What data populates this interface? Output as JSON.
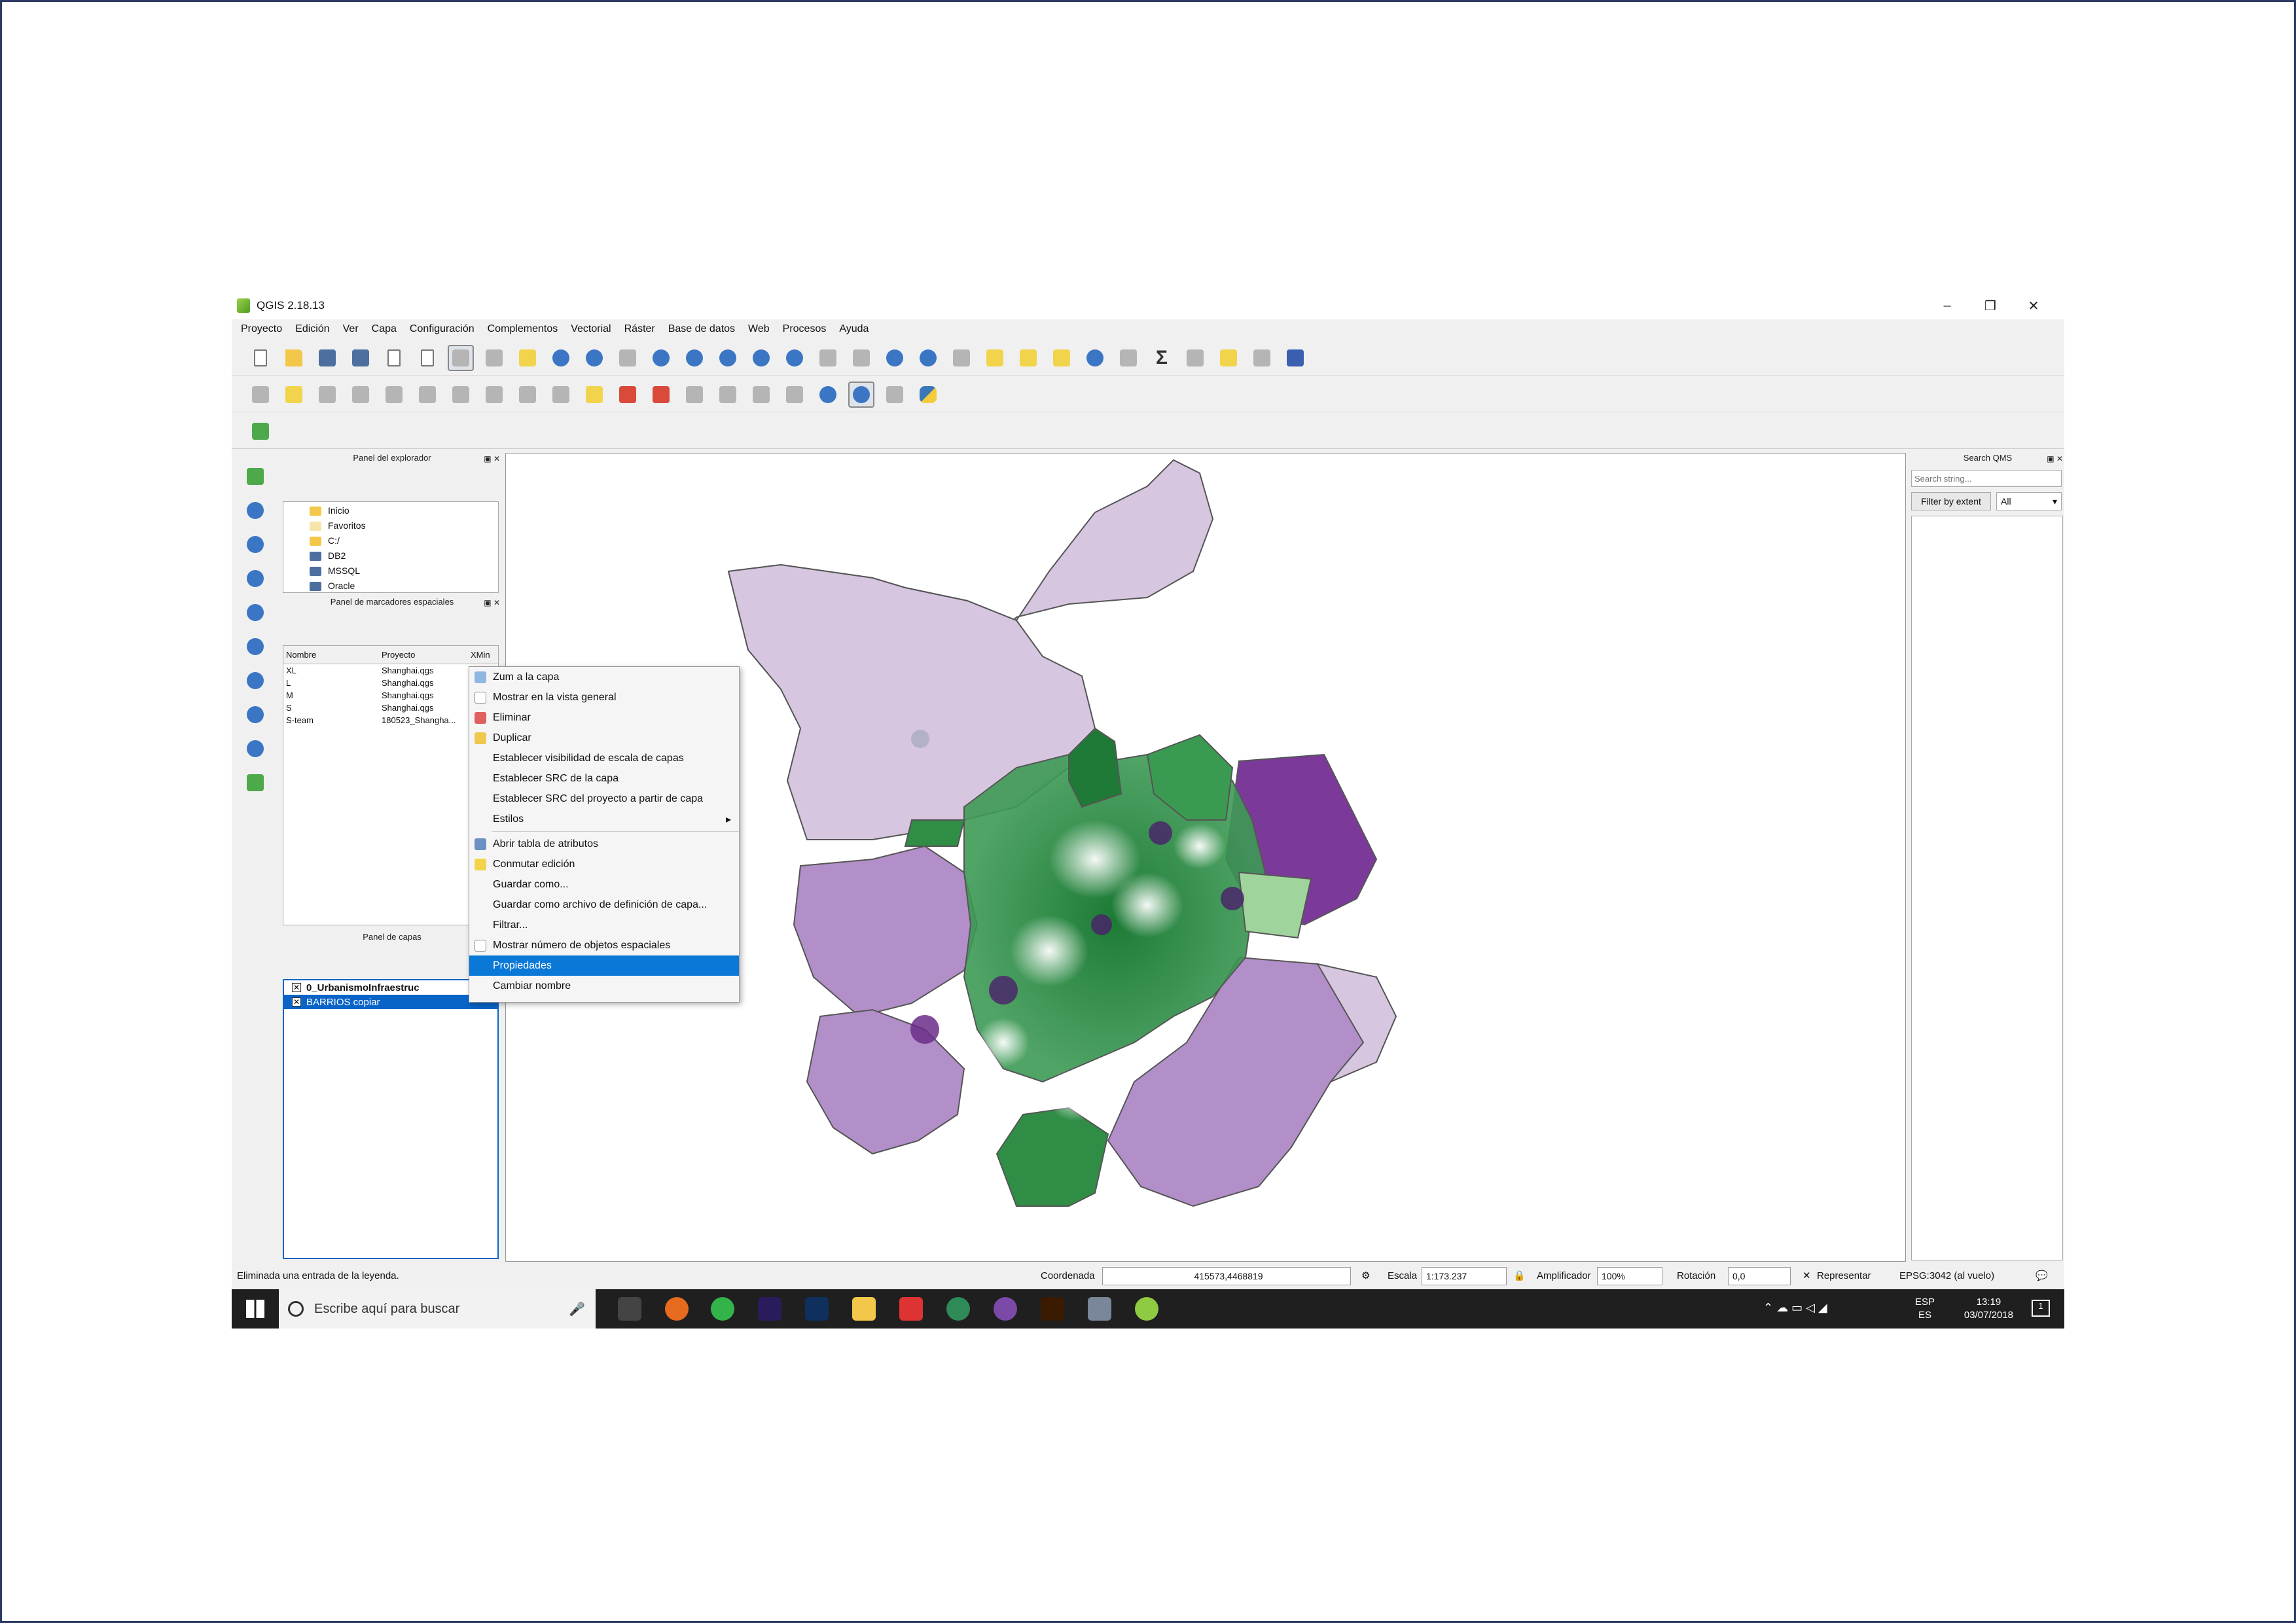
{
  "window": {
    "title": "QGIS 2.18.13"
  },
  "menu": [
    "Proyecto",
    "Edición",
    "Ver",
    "Capa",
    "Configuración",
    "Complementos",
    "Vectorial",
    "Ráster",
    "Base de datos",
    "Web",
    "Procesos",
    "Ayuda"
  ],
  "browser_panel": {
    "title": "Panel del explorador",
    "items": [
      "Inicio",
      "Favoritos",
      "C:/",
      "DB2",
      "MSSQL",
      "Oracle"
    ]
  },
  "bookmarks_panel": {
    "title": "Panel de marcadores espaciales",
    "headers": [
      "Nombre",
      "Proyecto",
      "XMin"
    ],
    "rows": [
      [
        "XL",
        "Shanghai.qgs"
      ],
      [
        "L",
        "Shanghai.qgs"
      ],
      [
        "M",
        "Shanghai.qgs"
      ],
      [
        "S",
        "Shanghai.qgs"
      ],
      [
        "S-team",
        "180523_Shangha..."
      ]
    ]
  },
  "layers_panel": {
    "title": "Panel de capas",
    "layers": [
      "0_UrbanismoInfraestruc",
      "BARRIOS copiar"
    ]
  },
  "qms_panel": {
    "title": "Search QMS",
    "placeholder": "Search string...",
    "filter_button": "Filter by extent",
    "filter_value": "All"
  },
  "context_menu": {
    "items": [
      "Zum a la capa",
      "Mostrar en la vista general",
      "Eliminar",
      "Duplicar",
      "Establecer visibilidad de escala de capas",
      "Establecer SRC de la capa",
      "Establecer SRC del proyecto a partir de capa",
      "Estilos",
      "Abrir tabla de atributos",
      "Conmutar edición",
      "Guardar como...",
      "Guardar como archivo de definición de capa...",
      "Filtrar...",
      "Mostrar número de objetos espaciales",
      "Propiedades",
      "Cambiar nombre"
    ],
    "highlighted": "Propiedades"
  },
  "status": {
    "message": "Eliminada una entrada de la leyenda.",
    "coord_label": "Coordenada",
    "coord_value": "415573,4468819",
    "scale_label": "Escala",
    "scale_value": "1:173.237",
    "magnifier_label": "Amplificador",
    "magnifier_value": "100%",
    "rotation_label": "Rotación",
    "rotation_value": "0,0",
    "render_label": "Representar",
    "crs": "EPSG:3042 (al vuelo)"
  },
  "taskbar": {
    "search_placeholder": "Escribe aquí para buscar",
    "lang_top": "ESP",
    "lang_bottom": "ES",
    "time": "13:19",
    "date": "03/07/2018",
    "notifications": "1"
  },
  "colors": {
    "accent": "#0a78d7",
    "map_light_purple": "#d7c6e0",
    "map_mid_purple": "#b28fc8",
    "map_dark_purple": "#7b3a9a",
    "map_green": "#2f8d46",
    "map_light_green": "#9fd59c"
  }
}
